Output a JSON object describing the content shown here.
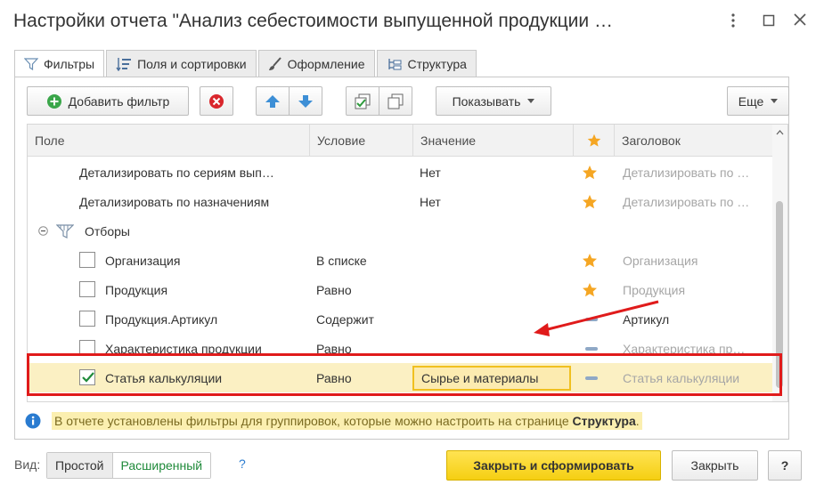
{
  "window": {
    "title": "Настройки отчета \"Анализ себестоимости выпущенной продукции …",
    "menu_icon": "more-vertical-icon",
    "minimize_icon": "maximize-icon",
    "close_icon": "close-icon"
  },
  "tabs": [
    {
      "label": "Фильтры",
      "icon": "filter-icon",
      "active": true
    },
    {
      "label": "Поля и сортировки",
      "icon": "fields-sort-icon",
      "active": false
    },
    {
      "label": "Оформление",
      "icon": "brush-icon",
      "active": false
    },
    {
      "label": "Структура",
      "icon": "structure-icon",
      "active": false
    }
  ],
  "toolbar": {
    "add_filter_label": "Добавить фильтр",
    "show_label": "Показывать",
    "more_label": "Еще"
  },
  "grid": {
    "headers": {
      "field": "Поле",
      "condition": "Условие",
      "value": "Значение",
      "title": "Заголовок"
    },
    "rows": [
      {
        "field": "Детализировать по сериям вып…",
        "condition": "",
        "value": "Нет",
        "star": true,
        "title": "Детализировать по …",
        "checkbox": false,
        "checked": false
      },
      {
        "field": "Детализировать по назначениям",
        "condition": "",
        "value": "Нет",
        "star": true,
        "title": "Детализировать по …",
        "checkbox": false,
        "checked": false
      },
      {
        "field": "Отборы",
        "group": true
      },
      {
        "field": "Организация",
        "condition": "В списке",
        "value": "",
        "star": true,
        "title": "Организация",
        "checkbox": true,
        "checked": false,
        "title_muted": true
      },
      {
        "field": "Продукция",
        "condition": "Равно",
        "value": "",
        "star": true,
        "title": "Продукция",
        "checkbox": true,
        "checked": false,
        "title_muted": true
      },
      {
        "field": "Продукция.Артикул",
        "condition": "Содержит",
        "value": "",
        "star": false,
        "title": "Артикул",
        "checkbox": true,
        "checked": false,
        "title_muted": false
      },
      {
        "field": "Характеристика продукции",
        "condition": "Равно",
        "value": "",
        "star": false,
        "title": "Характеристика пр…",
        "checkbox": true,
        "checked": false,
        "title_muted": true
      },
      {
        "field": "Статья калькуляции",
        "condition": "Равно",
        "value": "Сырье и материалы",
        "star": false,
        "title": "Статья калькуляции",
        "checkbox": true,
        "checked": true,
        "title_muted": true
      }
    ]
  },
  "info": {
    "text": "В отчете установлены фильтры для группировок, которые можно настроить на странице ",
    "link": "Структура",
    "suffix": "."
  },
  "footer": {
    "view_label": "Вид:",
    "simple_label": "Простой",
    "extended_label": "Расширенный",
    "help_q": "?",
    "close_generate_label": "Закрыть и сформировать",
    "close_label": "Закрыть",
    "help_button": "?"
  },
  "colors": {
    "selected_row": "#fbf0c3",
    "highlight_border": "#e01b1b",
    "primary_button": "#ffd92e",
    "star": "#f5a623",
    "arrow": "#e01b1b"
  }
}
